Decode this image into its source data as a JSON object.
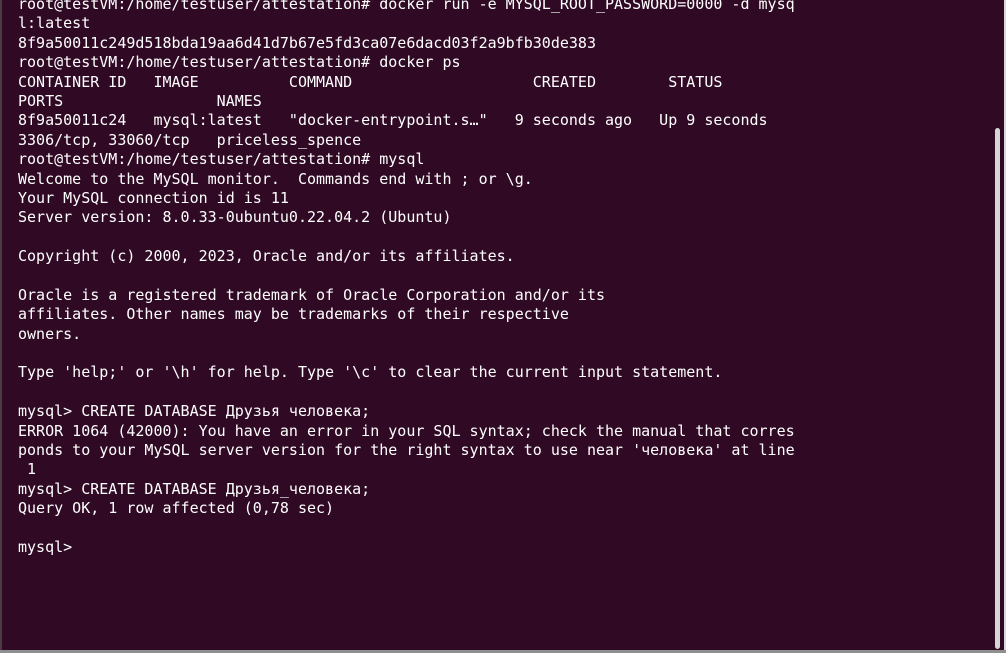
{
  "terminal": {
    "lines": [
      "root@testVM:/home/testuser/attestation# docker run -e MYSQL_ROOT_PASSWORD=0000 -d mysq",
      "l:latest",
      "8f9a50011c249d518bda19aa6d41d7b67e5fd3ca07e6dacd03f2a9bfb30de383",
      "root@testVM:/home/testuser/attestation# docker ps",
      "CONTAINER ID   IMAGE          COMMAND                    CREATED        STATUS",
      "PORTS                 NAMES",
      "8f9a50011c24   mysql:latest   \"docker-entrypoint.s…\"   9 seconds ago   Up 9 seconds",
      "3306/tcp, 33060/tcp   priceless_spence",
      "root@testVM:/home/testuser/attestation# mysql",
      "Welcome to the MySQL monitor.  Commands end with ; or \\g.",
      "Your MySQL connection id is 11",
      "Server version: 8.0.33-0ubuntu0.22.04.2 (Ubuntu)",
      "",
      "Copyright (c) 2000, 2023, Oracle and/or its affiliates.",
      "",
      "Oracle is a registered trademark of Oracle Corporation and/or its",
      "affiliates. Other names may be trademarks of their respective",
      "owners.",
      "",
      "Type 'help;' or '\\h' for help. Type '\\c' to clear the current input statement.",
      "",
      "mysql> CREATE DATABASE Друзья человека;",
      "ERROR 1064 (42000): You have an error in your SQL syntax; check the manual that corres",
      "ponds to your MySQL server version for the right syntax to use near 'человека' at line",
      " 1",
      "mysql> CREATE DATABASE Друзья_человека;",
      "Query OK, 1 row affected (0,78 sec)",
      "",
      "mysql> "
    ]
  },
  "colors": {
    "background": "#300a24",
    "foreground": "#ffffff",
    "scrollbar": "#d6d6d6"
  }
}
